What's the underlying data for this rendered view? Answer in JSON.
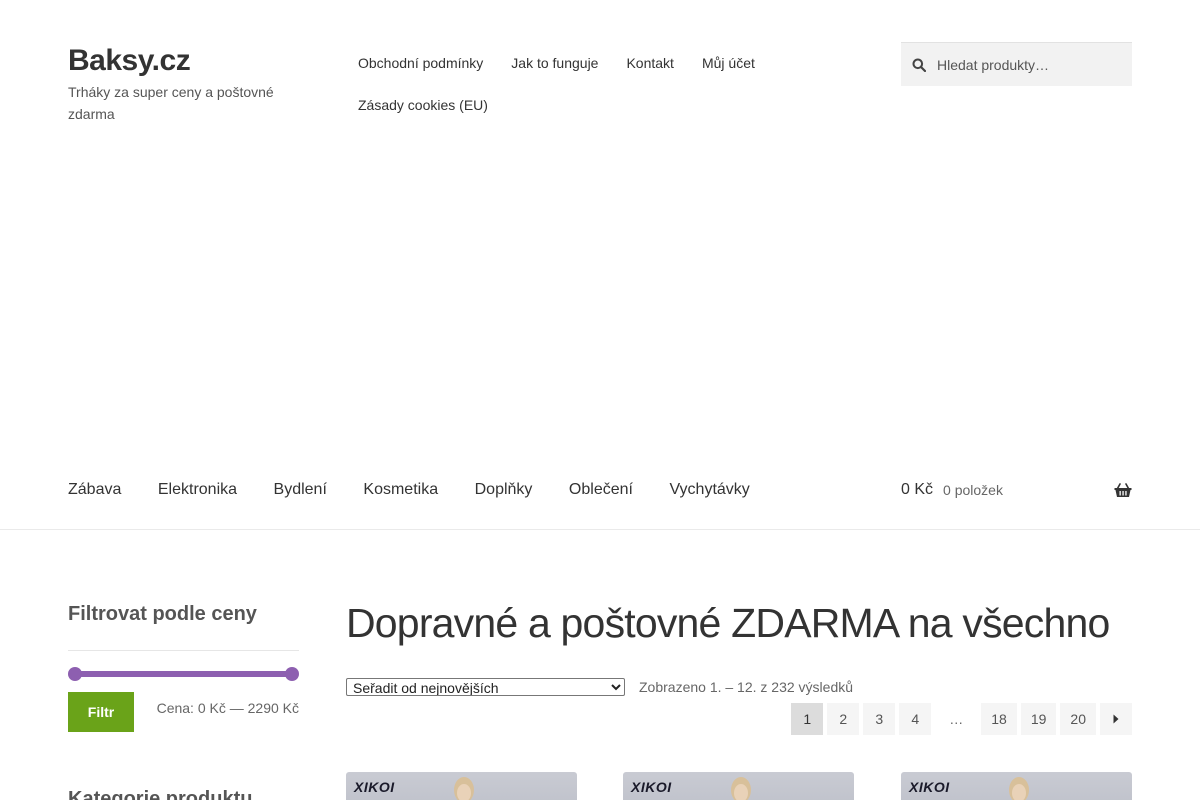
{
  "site": {
    "title": "Baksy.cz",
    "tagline": "Trháky za super ceny a poštovné zdarma"
  },
  "top_menu": [
    "Obchodní podmínky",
    "Jak to funguje",
    "Kontakt",
    "Můj účet",
    "Zásady cookies (EU)"
  ],
  "search": {
    "placeholder": "Hledat produkty…"
  },
  "main_nav": [
    "Zábava",
    "Elektronika",
    "Bydlení",
    "Kosmetika",
    "Doplňky",
    "Oblečení",
    "Vychytávky"
  ],
  "cart": {
    "amount": "0 Kč",
    "count": "0 položek",
    "icon": "basket-icon"
  },
  "sidebar": {
    "price_filter": {
      "title": "Filtrovat podle ceny",
      "button_label": "Filtr",
      "price_range": "Cena: 0 Kč — 2290 Kč",
      "min_fraction": 0,
      "max_fraction": 1
    },
    "categories": {
      "title": "Kategorie produktu"
    }
  },
  "main": {
    "heading": "Dopravné a poštovné ZDARMA na všechno",
    "sort": {
      "selected": "Seřadit od nejnovějších"
    },
    "result_count": "Zobrazeno 1. – 12. z 232 výsledků",
    "pagination": [
      "1",
      "2",
      "3",
      "4",
      "…",
      "18",
      "19",
      "20"
    ],
    "current_page": "1",
    "products": [
      {
        "brand": "XIKOI"
      },
      {
        "brand": "XIKOI"
      },
      {
        "brand": "XIKOI"
      }
    ]
  },
  "colors": {
    "accent_purple": "#8d5fb0",
    "button_green": "#6aa319"
  }
}
